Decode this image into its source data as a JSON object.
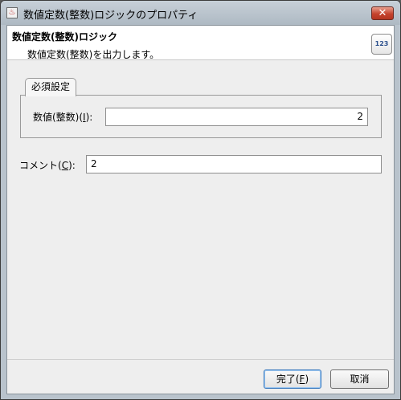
{
  "window": {
    "title": "数値定数(整数)ロジックのプロパティ",
    "close_glyph": "✕"
  },
  "header": {
    "title": "数値定数(整数)ロジック",
    "description": "数値定数(整数)を出力します。",
    "badge": "123"
  },
  "tab": {
    "label": "必須設定"
  },
  "value_field": {
    "label_prefix": "数値(整数)(",
    "mnemonic": "I",
    "label_suffix": "):",
    "value": "2"
  },
  "comment_field": {
    "label_prefix": "コメント(",
    "mnemonic": "C",
    "label_suffix": "):",
    "value": "2"
  },
  "buttons": {
    "finish_prefix": "完了(",
    "finish_mnemonic": "F",
    "finish_suffix": ")",
    "cancel": "取消"
  },
  "icons": {
    "app": "java-app-icon",
    "close": "close-icon"
  }
}
